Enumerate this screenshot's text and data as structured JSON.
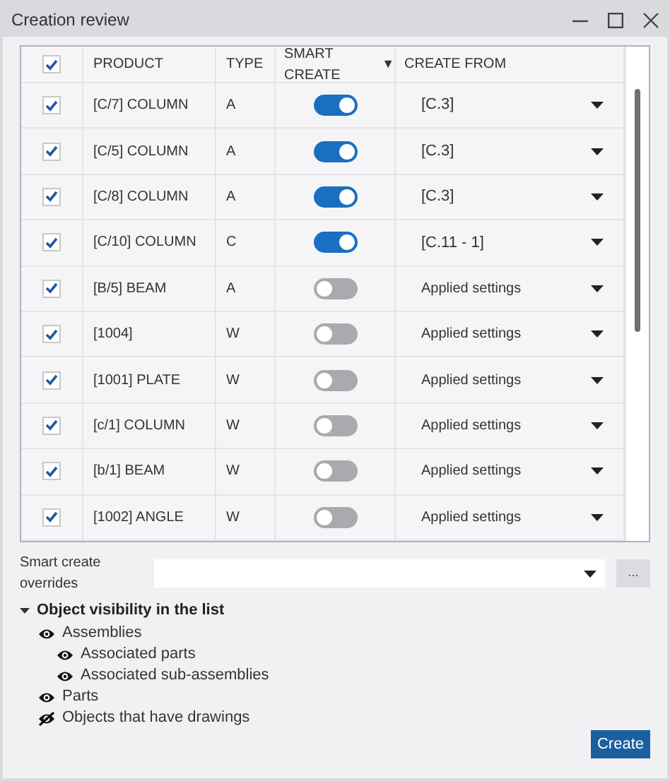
{
  "window": {
    "title": "Creation review"
  },
  "table": {
    "all_checked": true,
    "columns": [
      "PRODUCT",
      "TYPE",
      "SMART CREATE",
      "CREATE FROM"
    ],
    "sort_indicator": "▼",
    "rows": [
      {
        "checked": true,
        "product": "[C/7] COLUMN",
        "type": "A",
        "smart_create": true,
        "create_from": "[C.3]"
      },
      {
        "checked": true,
        "product": "[C/5] COLUMN",
        "type": "A",
        "smart_create": true,
        "create_from": "[C.3]"
      },
      {
        "checked": true,
        "product": "[C/8] COLUMN",
        "type": "A",
        "smart_create": true,
        "create_from": "[C.3]"
      },
      {
        "checked": true,
        "product": "[C/10] COLUMN",
        "type": "C",
        "smart_create": true,
        "create_from": "[C.11 - 1]"
      },
      {
        "checked": true,
        "product": "[B/5] BEAM",
        "type": "A",
        "smart_create": false,
        "create_from": "Applied settings"
      },
      {
        "checked": true,
        "product": "[1004]",
        "type": "W",
        "smart_create": false,
        "create_from": "Applied settings"
      },
      {
        "checked": true,
        "product": "[1001] PLATE",
        "type": "W",
        "smart_create": false,
        "create_from": "Applied settings"
      },
      {
        "checked": true,
        "product": "[c/1] COLUMN",
        "type": "W",
        "smart_create": false,
        "create_from": "Applied settings"
      },
      {
        "checked": true,
        "product": "[b/1] BEAM",
        "type": "W",
        "smart_create": false,
        "create_from": "Applied settings"
      },
      {
        "checked": true,
        "product": "[1002] ANGLE",
        "type": "W",
        "smart_create": false,
        "create_from": "Applied settings"
      }
    ]
  },
  "overrides": {
    "label": "Smart create overrides",
    "button": "..."
  },
  "visibility": {
    "title": "Object visibility in the list",
    "expanded": true,
    "items": [
      {
        "label": "Assemblies",
        "visible": true,
        "children": [
          {
            "label": "Associated parts",
            "visible": true
          },
          {
            "label": "Associated sub-assemblies",
            "visible": true
          }
        ]
      },
      {
        "label": "Parts",
        "visible": true
      },
      {
        "label": "Objects that have drawings",
        "visible": false
      }
    ]
  },
  "create_button": "Create"
}
